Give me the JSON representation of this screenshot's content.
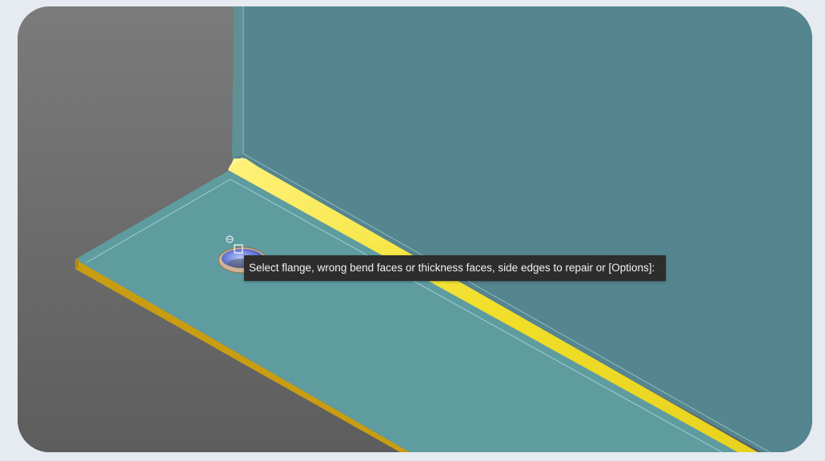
{
  "viewport": {
    "colors": {
      "background_gray": "#6e6e6e",
      "wall_face": "#55858e",
      "flange_face": "#5f9ca0",
      "bend_highlight": "#f5e63a",
      "edge_gold": "#c99d12"
    }
  },
  "command_prompt": {
    "text": "Select flange, wrong bend faces or thickness faces, side edges to repair or [Options]:"
  },
  "cursor": {
    "icon": "pick-box-cursor-icon"
  }
}
